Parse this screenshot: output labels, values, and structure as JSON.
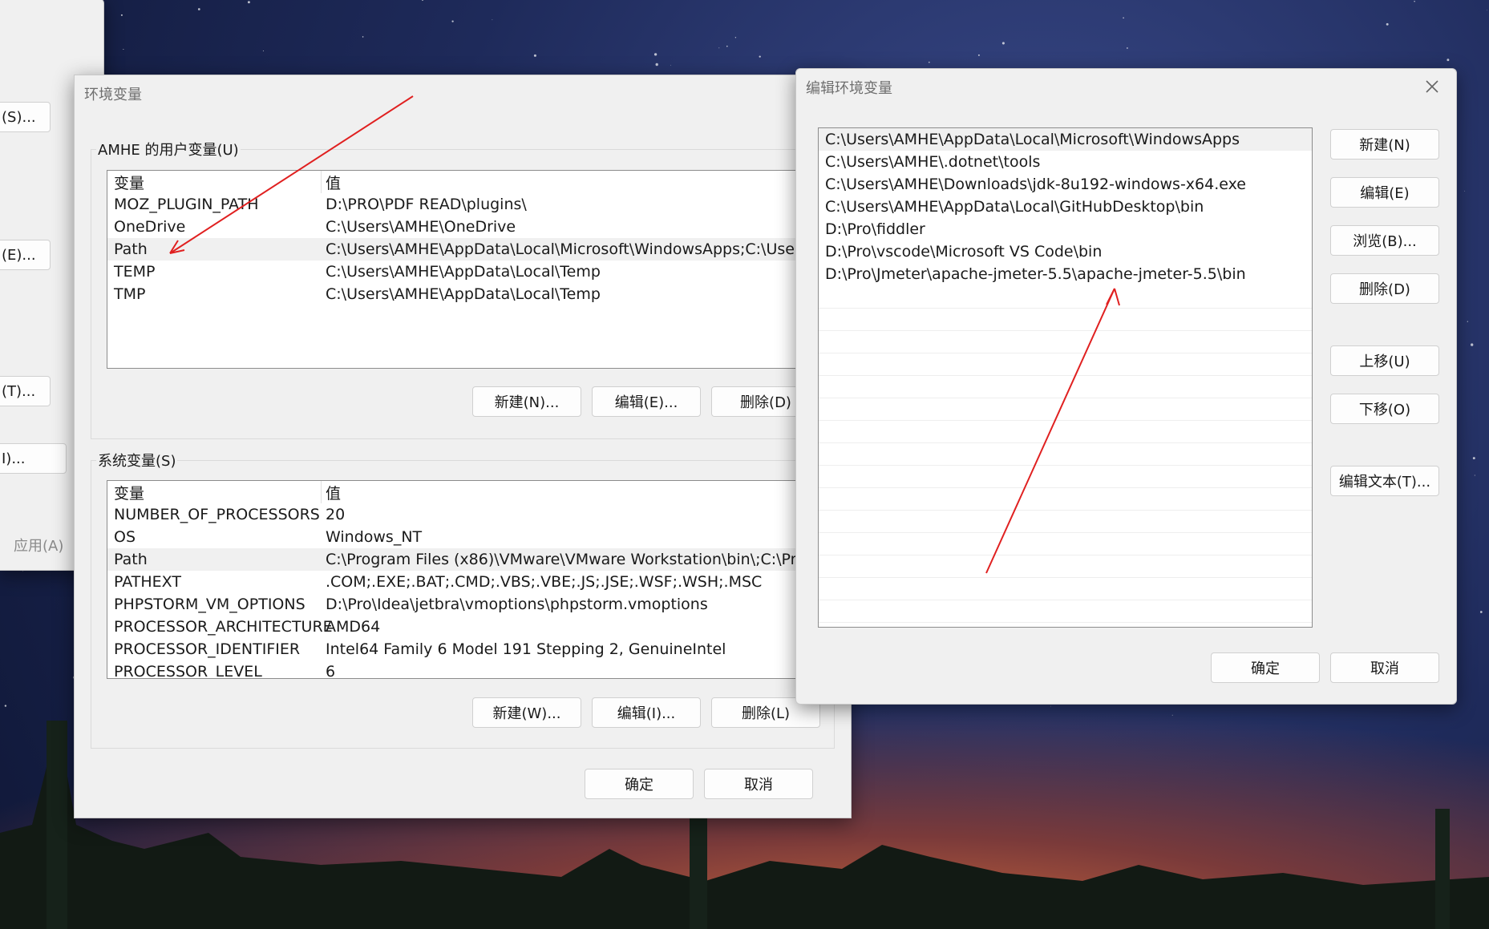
{
  "background_window": {
    "buttons": [
      "(S)...",
      "(E)...",
      "(T)...",
      "I)..."
    ],
    "apply_label": "应用(A)"
  },
  "env_dialog": {
    "title": "环境变量",
    "user_group_label": "AMHE 的用户变量(U)",
    "user_headers": [
      "变量",
      "值"
    ],
    "user_rows": [
      {
        "name": "MOZ_PLUGIN_PATH",
        "value": "D:\\PRO\\PDF READ\\plugins\\"
      },
      {
        "name": "OneDrive",
        "value": "C:\\Users\\AMHE\\OneDrive"
      },
      {
        "name": "Path",
        "value": "C:\\Users\\AMHE\\AppData\\Local\\Microsoft\\WindowsApps;C:\\Users\\..."
      },
      {
        "name": "TEMP",
        "value": "C:\\Users\\AMHE\\AppData\\Local\\Temp"
      },
      {
        "name": "TMP",
        "value": "C:\\Users\\AMHE\\AppData\\Local\\Temp"
      }
    ],
    "user_buttons": {
      "new": "新建(N)...",
      "edit": "编辑(E)...",
      "delete": "删除(D)"
    },
    "system_group_label": "系统变量(S)",
    "system_headers": [
      "变量",
      "值"
    ],
    "system_rows": [
      {
        "name": "NUMBER_OF_PROCESSORS",
        "value": "20"
      },
      {
        "name": "OS",
        "value": "Windows_NT"
      },
      {
        "name": "Path",
        "value": "C:\\Program Files (x86)\\VMware\\VMware Workstation\\bin\\;C:\\Prog..."
      },
      {
        "name": "PATHEXT",
        "value": ".COM;.EXE;.BAT;.CMD;.VBS;.VBE;.JS;.JSE;.WSF;.WSH;.MSC"
      },
      {
        "name": "PHPSTORM_VM_OPTIONS",
        "value": "D:\\Pro\\Idea\\jetbra\\vmoptions\\phpstorm.vmoptions"
      },
      {
        "name": "PROCESSOR_ARCHITECTURE",
        "value": "AMD64"
      },
      {
        "name": "PROCESSOR_IDENTIFIER",
        "value": "Intel64 Family 6 Model 191 Stepping 2, GenuineIntel"
      },
      {
        "name": "PROCESSOR_LEVEL",
        "value": "6"
      }
    ],
    "system_buttons": {
      "new": "新建(W)...",
      "edit": "编辑(I)...",
      "delete": "删除(L)"
    },
    "ok": "确定",
    "cancel": "取消"
  },
  "edit_dialog": {
    "title": "编辑环境变量",
    "entries": [
      "C:\\Users\\AMHE\\AppData\\Local\\Microsoft\\WindowsApps",
      "C:\\Users\\AMHE\\.dotnet\\tools",
      "C:\\Users\\AMHE\\Downloads\\jdk-8u192-windows-x64.exe",
      "C:\\Users\\AMHE\\AppData\\Local\\GitHubDesktop\\bin",
      "D:\\Pro\\fiddler",
      "D:\\Pro\\vscode\\Microsoft VS Code\\bin",
      "D:\\Pro\\Jmeter\\apache-jmeter-5.5\\apache-jmeter-5.5\\bin"
    ],
    "buttons": {
      "new": "新建(N)",
      "edit": "编辑(E)",
      "browse": "浏览(B)...",
      "delete": "删除(D)",
      "move_up": "上移(U)",
      "move_down": "下移(O)",
      "edit_text": "编辑文本(T)..."
    },
    "ok": "确定",
    "cancel": "取消",
    "close_icon": "close-icon"
  },
  "annotation_color": "#e02020"
}
